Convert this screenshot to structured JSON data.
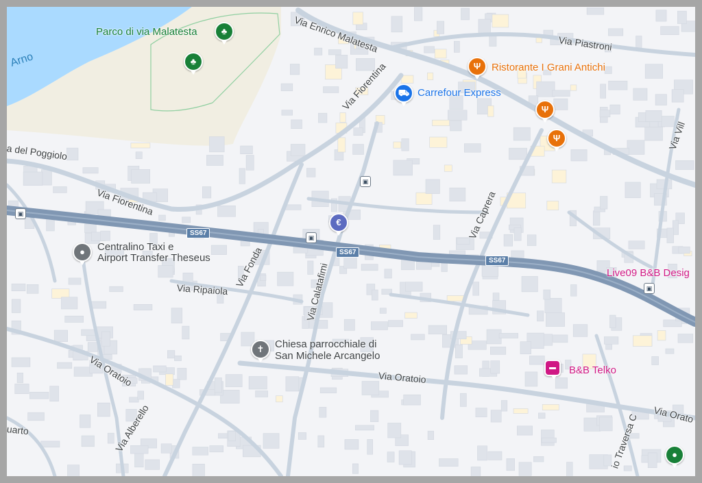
{
  "colors": {
    "water": "#aadaff",
    "park": "#f1eee2",
    "road_major": "#8097b3",
    "road_minor": "#c8d3df",
    "building": "#dfe3ea",
    "building_warm": "#fdf3d8",
    "background": "#f3f4f7"
  },
  "map": {
    "water_labels": {
      "arno": "Arno"
    },
    "streets": {
      "enrico_malatesta": "Via Enrico Malatesta",
      "piastroni": "Via Piastroni",
      "fiorentina_top": "Via Fiorentina",
      "fiorentina_left": "Via Fiorentina",
      "poggiolo": "a del Poggiolo",
      "caprera": "Via Caprera",
      "fonda": "Via Fonda",
      "ripaiola": "Via Ripaiola",
      "calatafimi": "Via Calatafimi",
      "oratoio_left": "Via Oratoio",
      "oratoio_center": "Via Oratoio",
      "oratoio_right": "Via Orato",
      "alberello": "Via Alberello",
      "quarto": "uarto",
      "traversa": "io Traversa C",
      "villa": "Via Vill"
    },
    "road_shields": [
      "SS67",
      "SS67",
      "SS67"
    ],
    "pois": {
      "parco": "Parco di via Malatesta",
      "ristorante": "Ristorante I Grani Antichi",
      "carrefour": "Carrefour Express",
      "taxi_line1": "Centralino Taxi e",
      "taxi_line2": "Airport Transfer Theseus",
      "chiesa_line1": "Chiesa parrocchiale di",
      "chiesa_line2": "San Michele Arcangelo",
      "live09": "Live09 B&B Desig",
      "telko": "B&B Telko"
    },
    "icons": {
      "tree": "tree-icon",
      "food": "fork-knife-icon",
      "cart": "shopping-cart-icon",
      "euro": "euro-icon",
      "bus": "bus-stop-icon",
      "hotel": "bed-icon",
      "church": "cross-icon",
      "place": "place-icon"
    },
    "glyphs": {
      "tree": "♣",
      "food": "Ψ",
      "cart": "⛟",
      "euro": "€",
      "bus": "▣",
      "hotel": "▬",
      "church": "✝",
      "place": "●"
    }
  }
}
